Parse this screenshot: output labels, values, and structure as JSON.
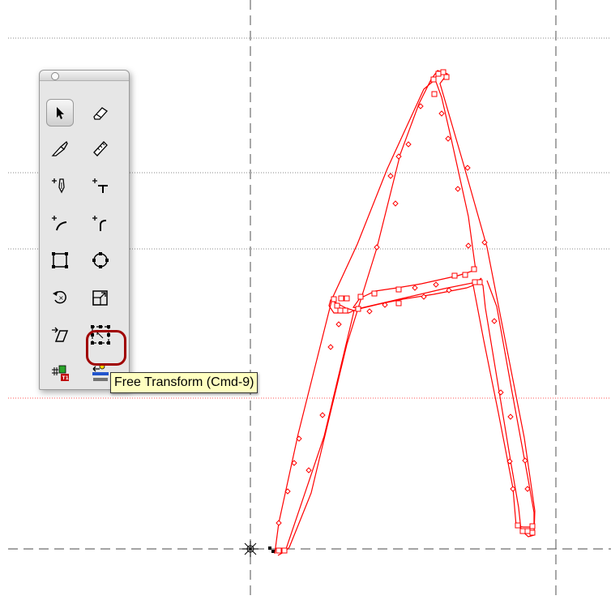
{
  "tooltip": {
    "text": "Free Transform (Cmd-9)"
  },
  "palette": {
    "tools": [
      {
        "name": "pointer-tool-button",
        "icon": "arrow-pointer-icon",
        "selected": true
      },
      {
        "name": "eraser-tool-button",
        "icon": "eraser-icon"
      },
      {
        "name": "knife-tool-button",
        "icon": "knife-icon"
      },
      {
        "name": "measure-tool-button",
        "icon": "ruler-icon"
      },
      {
        "name": "add-corner-point-button",
        "icon": "pen-corner-icon"
      },
      {
        "name": "add-tangent-point-button",
        "icon": "pen-tangent-icon"
      },
      {
        "name": "add-curve-point-button",
        "icon": "pen-curve-icon"
      },
      {
        "name": "add-smooth-point-button",
        "icon": "pen-smooth-icon"
      },
      {
        "name": "rectangle-tool-button",
        "icon": "rectangle-icon"
      },
      {
        "name": "ellipse-tool-button",
        "icon": "ellipse-icon"
      },
      {
        "name": "rotate-tool-button",
        "icon": "rotate-icon"
      },
      {
        "name": "scale-tool-button",
        "icon": "scale-icon"
      },
      {
        "name": "skew-tool-button",
        "icon": "skew-icon"
      },
      {
        "name": "free-transform-button",
        "icon": "free-transform-icon",
        "highlighted": true
      },
      {
        "name": "hint-tool-button",
        "icon": "hint-grid-icon"
      },
      {
        "name": "link-tool-button",
        "icon": "link-hint-icon"
      }
    ]
  },
  "colors": {
    "outline": "#ff0000",
    "guides": "#7a7a7a",
    "baseline_guide": "#ff6666",
    "highlight": "#a00000",
    "tooltip_bg": "#ffffc0"
  }
}
